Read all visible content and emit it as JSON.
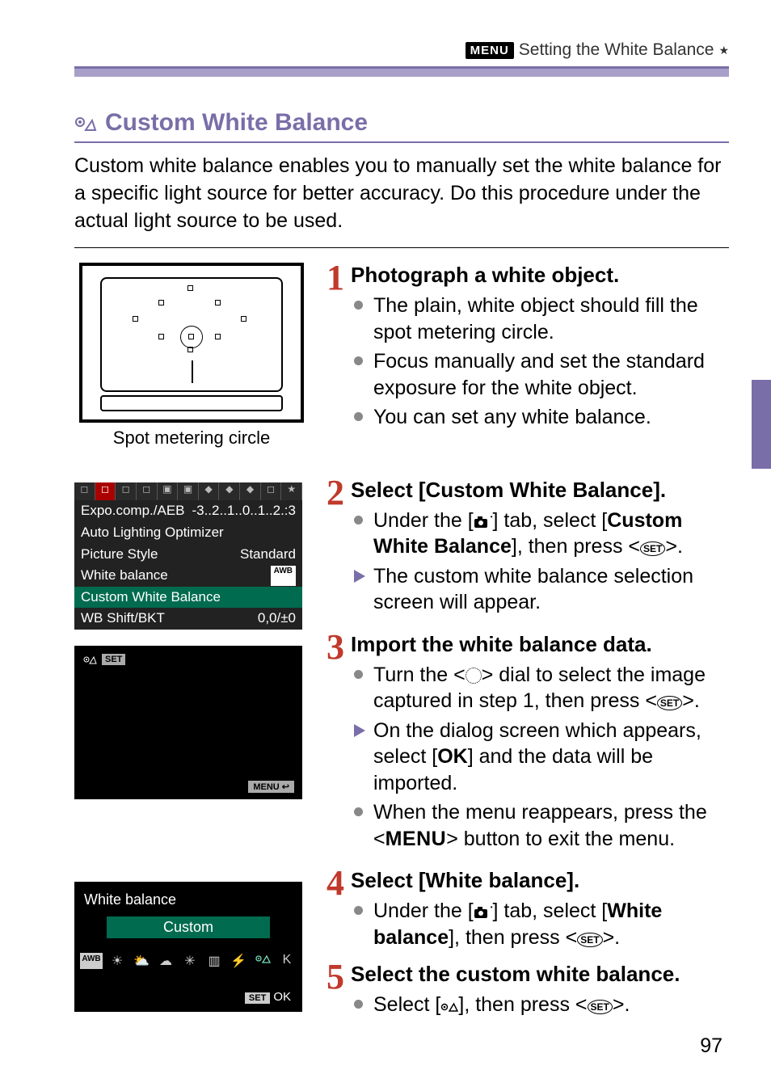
{
  "header": {
    "menu_badge": "MENU",
    "title": "Setting the White Balance",
    "star": "★"
  },
  "section": {
    "title": "Custom White Balance"
  },
  "intro": "Custom white balance enables you to manually set the white balance for a specific light source for better accuracy. Do this procedure under the actual light source to be used.",
  "vf_label": "Spot metering circle",
  "steps": {
    "s1": {
      "title": "Photograph a white object.",
      "b1": "The plain, white object should fill the spot metering circle.",
      "b2": "Focus manually and set the standard exposure for the white object.",
      "b3": "You can set any white balance."
    },
    "s2": {
      "title": "Select [Custom White Balance].",
      "b1a": "Under the [",
      "b1b": "] tab, select [",
      "b1c": "Custom White Balance",
      "b1d": "], then press <",
      "b1e": ">.",
      "b2": "The custom white balance selection screen will appear."
    },
    "s3": {
      "title": "Import the white balance data.",
      "b1a": "Turn the <",
      "b1b": "> dial to select the image captured in step 1, then press <",
      "b1c": ">.",
      "b2a": "On the dialog screen which appears, select [",
      "b2b": "OK",
      "b2c": "] and the data will be imported.",
      "b3a": "When the menu reappears, press the <",
      "b3b": "> button to exit the menu."
    },
    "s4": {
      "title": "Select [White balance].",
      "b1a": "Under the [",
      "b1b": "] tab, select [",
      "b1c": "White balance",
      "b1d": "], then press <",
      "b1e": ">."
    },
    "s5": {
      "title": "Select the custom white balance.",
      "b1a": "Select [",
      "b1b": "], then press <",
      "b1c": ">."
    }
  },
  "lcd1": {
    "r1a": "Expo.comp./AEB",
    "r1b": "-3..2..1..0..1..2.:3",
    "r2a": "Auto Lighting Optimizer",
    "r3a": "Picture Style",
    "r3b": "Standard",
    "r4a": "White balance",
    "r4b": "AWB",
    "r5a": "Custom White Balance",
    "r6a": "WB Shift/BKT",
    "r6b": "0,0/±0"
  },
  "lcd2": {
    "tl": "SET",
    "br": "MENU ↩"
  },
  "lcd3": {
    "title": "White balance",
    "selected": "Custom",
    "icons": [
      "AWB",
      "☀",
      "⛅",
      "☁",
      "✳",
      "▥",
      "⚡",
      "⬚",
      "K"
    ],
    "ok": "SET  OK"
  },
  "set_label": "SET",
  "menu_label": "MENU",
  "page_num": "97"
}
